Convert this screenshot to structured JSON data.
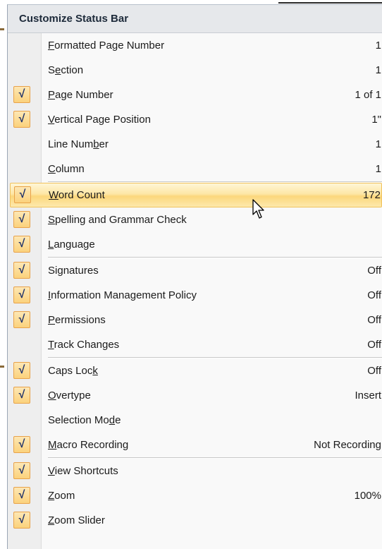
{
  "menu": {
    "title": "Customize Status Bar",
    "check_glyph": "√",
    "groups": [
      [
        {
          "pre": "",
          "key": "F",
          "post": "ormatted Page Number",
          "value": "1",
          "checked": false
        },
        {
          "pre": "S",
          "key": "e",
          "post": "ction",
          "value": "1",
          "checked": false
        },
        {
          "pre": "",
          "key": "P",
          "post": "age Number",
          "value": "1 of 1",
          "checked": true
        },
        {
          "pre": "",
          "key": "V",
          "post": "ertical Page Position",
          "value": "1\"",
          "checked": true
        },
        {
          "pre": "Line Num",
          "key": "b",
          "post": "er",
          "value": "1",
          "checked": false
        },
        {
          "pre": "",
          "key": "C",
          "post": "olumn",
          "value": "1",
          "checked": false
        }
      ],
      [
        {
          "pre": "",
          "key": "W",
          "post": "ord Count",
          "value": "172",
          "checked": true,
          "highlighted": true
        },
        {
          "pre": "",
          "key": "S",
          "post": "pelling and Grammar Check",
          "value": "",
          "checked": true
        },
        {
          "pre": "",
          "key": "L",
          "post": "anguage",
          "value": "",
          "checked": true
        }
      ],
      [
        {
          "pre": "Si",
          "key": "g",
          "post": "natures",
          "value": "Off",
          "checked": true
        },
        {
          "pre": "",
          "key": "I",
          "post": "nformation Management Policy",
          "value": "Off",
          "checked": true
        },
        {
          "pre": "",
          "key": "P",
          "post": "ermissions",
          "value": "Off",
          "checked": true
        },
        {
          "pre": "",
          "key": "T",
          "post": "rack Changes",
          "value": "Off",
          "checked": false
        }
      ],
      [
        {
          "pre": "Caps Loc",
          "key": "k",
          "post": "",
          "value": "Off",
          "checked": true
        },
        {
          "pre": "",
          "key": "O",
          "post": "vertype",
          "value": "Insert",
          "checked": true
        },
        {
          "pre": "Selection Mo",
          "key": "d",
          "post": "e",
          "value": "",
          "checked": false
        },
        {
          "pre": "",
          "key": "M",
          "post": "acro Recording",
          "value": "Not Recording",
          "checked": true
        }
      ],
      [
        {
          "pre": "",
          "key": "V",
          "post": "iew Shortcuts",
          "value": "",
          "checked": true
        },
        {
          "pre": "",
          "key": "Z",
          "post": "oom",
          "value": "100%",
          "checked": true
        },
        {
          "pre": "",
          "key": "Z",
          "post": "oom Slider",
          "value": "",
          "checked": true
        }
      ]
    ]
  }
}
